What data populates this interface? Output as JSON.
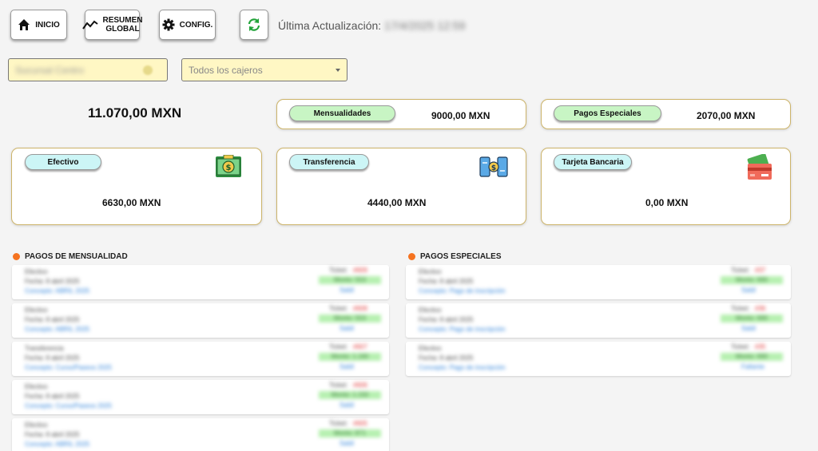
{
  "nav": {
    "inicio": "INICIO",
    "resumen_1": "RESUMEN",
    "resumen_2": "GLOBAL",
    "config": "CONFIG."
  },
  "updated": {
    "label": "Última Actualización:",
    "value": "17/4/2025 12:59"
  },
  "filters": {
    "sucursal_value": "Sucursal Centro",
    "cajero_placeholder": "Todos los cajeros"
  },
  "summary": {
    "total": "11.070,00 MXN",
    "mensualidades_label": "Mensualidades",
    "mensualidades_value": "9000,00 MXN",
    "especiales_label": "Pagos Especiales",
    "especiales_value": "2070,00 MXN"
  },
  "methods": {
    "efectivo_label": "Efectivo",
    "efectivo_value": "6630,00 MXN",
    "transferencia_label": "Transferencia",
    "transferencia_value": "4440,00 MXN",
    "tarjeta_label": "Tarjeta Bancaria",
    "tarjeta_value": "0,00 MXN"
  },
  "sections": {
    "mensualidad_title": "PAGOS DE MENSUALIDAD",
    "especiales_title": "PAGOS ESPECIALES"
  },
  "colors": {
    "accent_dot": "#f57320",
    "pill_green": "#c8f5c4",
    "pill_blue": "#ccf5f6",
    "card_border": "#cdb46a",
    "filter_bg": "#fff7c4"
  },
  "icons": [
    "home-icon",
    "trend-line-icon",
    "gear-icon",
    "refresh-icon",
    "cash-icon",
    "transfer-phones-icon",
    "credit-card-icon"
  ],
  "mensualidad_items": [
    {
      "line1": "Efectivo",
      "line2": "Fecha: 8 abril 2025",
      "line3": "Concepto: ABRIL 2025",
      "ticket_label": "Ticket:",
      "ticket_value": "#609",
      "monto": "Monto: 553",
      "status": "Saldí"
    },
    {
      "line1": "Efectivo",
      "line2": "Fecha: 8 abril 2025",
      "line3": "Concepto: ABRIL 2025",
      "ticket_label": "Ticket:",
      "ticket_value": "#608",
      "monto": "Monto: 553",
      "status": "Saldí"
    },
    {
      "line1": "Transferencia",
      "line2": "Fecha: 8 abril 2025",
      "line3": "Concepto: Curso/Paseos 2025",
      "ticket_label": "Ticket:",
      "ticket_value": "#607",
      "monto": "Monto: 1.160",
      "status": "Saldí"
    },
    {
      "line1": "Efectivo",
      "line2": "Fecha: 8 abril 2025",
      "line3": "Concepto: Curso/Paseos 2025",
      "ticket_label": "Ticket:",
      "ticket_value": "#606",
      "monto": "Monto: 1.150",
      "status": "Saldí"
    },
    {
      "line1": "Efectivo",
      "line2": "Fecha: 8 abril 2025",
      "line3": "Concepto: ABRIL 2025",
      "ticket_label": "Ticket:",
      "ticket_value": "#605",
      "monto": "Monto: 871",
      "status": "Saldí"
    }
  ],
  "especiales_items": [
    {
      "line1": "Efectivo",
      "line2": "Fecha: 8 abril 2025",
      "line3": "Concepto: Pago de inscripción",
      "ticket_label": "Ticket:",
      "ticket_value": "#37",
      "monto": "Monto: 690",
      "status": "Saldí"
    },
    {
      "line1": "Efectivo",
      "line2": "Fecha: 8 abril 2025",
      "line3": "Concepto: Pago de inscripción",
      "ticket_label": "Ticket:",
      "ticket_value": "#36",
      "monto": "Monto: 690",
      "status": "Saldí"
    },
    {
      "line1": "Efectivo",
      "line2": "Fecha: 8 abril 2025",
      "line3": "Concepto: Pago de inscripción",
      "ticket_label": "Ticket:",
      "ticket_value": "#35",
      "monto": "Monto: 690",
      "status": "Faltante"
    }
  ]
}
